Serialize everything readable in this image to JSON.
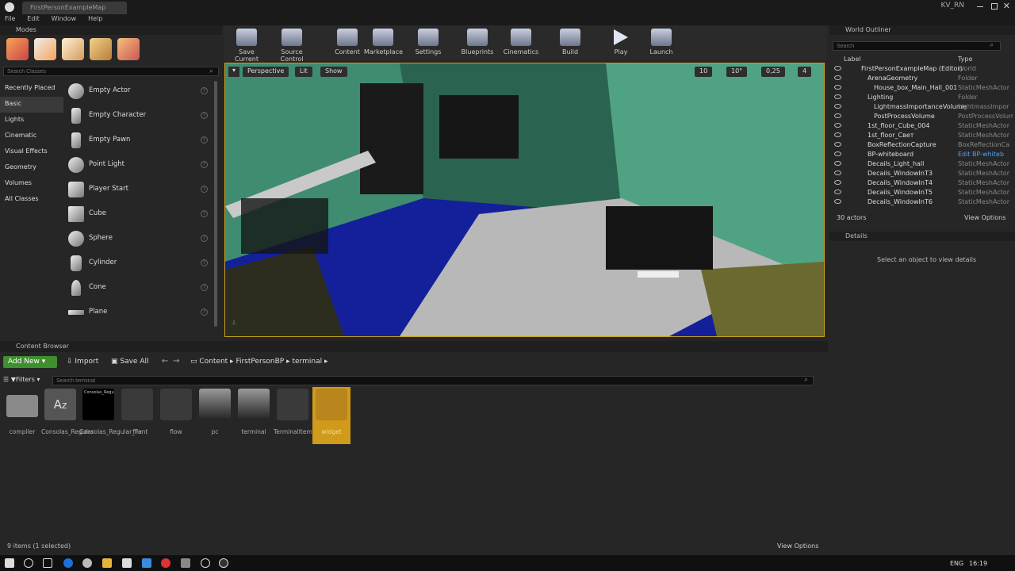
{
  "window": {
    "tab_title": "FirstPersonExampleMap",
    "user": "KV_RN"
  },
  "menu": [
    "File",
    "Edit",
    "Window",
    "Help"
  ],
  "modes": {
    "title": "Modes",
    "search_placeholder": "Search Classes",
    "categories": [
      "Recently Placed",
      "Basic",
      "Lights",
      "Cinematic",
      "Visual Effects",
      "Geometry",
      "Volumes",
      "All Classes"
    ],
    "items": [
      "Empty Actor",
      "Empty Character",
      "Empty Pawn",
      "Point Light",
      "Player Start",
      "Cube",
      "Sphere",
      "Cylinder",
      "Cone",
      "Plane"
    ]
  },
  "toolbar": [
    "Save Current",
    "Source Control",
    "Content",
    "Marketplace",
    "Settings",
    "Blueprints",
    "Cinematics",
    "Build",
    "Play",
    "Launch"
  ],
  "viewport": {
    "perspective": "Perspective",
    "lit": "Lit",
    "show": "Show",
    "snap_grid": "10",
    "snap_rot": "10°",
    "snap_scale": "0,25",
    "cam_speed": "4"
  },
  "outliner": {
    "title": "World Outliner",
    "search_placeholder": "Search",
    "col_label": "Label",
    "col_type": "Type",
    "rows": [
      {
        "label": "FirstPersonExampleMap (Editor)",
        "type": "World"
      },
      {
        "label": "ArenaGeometry",
        "type": "Folder"
      },
      {
        "label": "House_box_Main_Hall_001",
        "type": "StaticMeshActor"
      },
      {
        "label": "Lighting",
        "type": "Folder"
      },
      {
        "label": "LightmassImportanceVolume",
        "type": "LightmassImpor"
      },
      {
        "label": "PostProcessVolume",
        "type": "PostProcessVolume"
      },
      {
        "label": "1st_floor_Cube_004",
        "type": "StaticMeshActor"
      },
      {
        "label": "1st_floor_Свет",
        "type": "StaticMeshActor"
      },
      {
        "label": "BoxReflectionCapture",
        "type": "BoxReflectionCa"
      },
      {
        "label": "BP-whiteboard",
        "type": "Edit BP-whiteb"
      },
      {
        "label": "Decails_Light_hall",
        "type": "StaticMeshActor"
      },
      {
        "label": "Decails_WindowInT3",
        "type": "StaticMeshActor"
      },
      {
        "label": "Decails_WindowInT4",
        "type": "StaticMeshActor"
      },
      {
        "label": "Decails_WindowInT5",
        "type": "StaticMeshActor"
      },
      {
        "label": "Decails_WindowInT6",
        "type": "StaticMeshActor"
      }
    ],
    "count": "30 actors",
    "view_options": "View Options"
  },
  "details": {
    "title": "Details",
    "empty_text": "Select an object to view details"
  },
  "content_browser": {
    "title": "Content Browser",
    "add_new": "Add New",
    "import": "Import",
    "save_all": "Save All",
    "path": [
      "Content",
      "FirstPersonBP",
      "terminal"
    ],
    "filters": "Filters",
    "search_placeholder": "Search terminal",
    "assets": [
      "compiler",
      "Consolas_Regular",
      "Consolas_Regular_Font",
      "file",
      "flow",
      "pc",
      "terminal",
      "TerminalItem",
      "widget"
    ],
    "consolas_thumb_text": "Consolas_Regu",
    "status": "9 items (1 selected)",
    "view_options": "View Options"
  },
  "taskbar": {
    "lang": "ENG",
    "time": "16:19"
  }
}
